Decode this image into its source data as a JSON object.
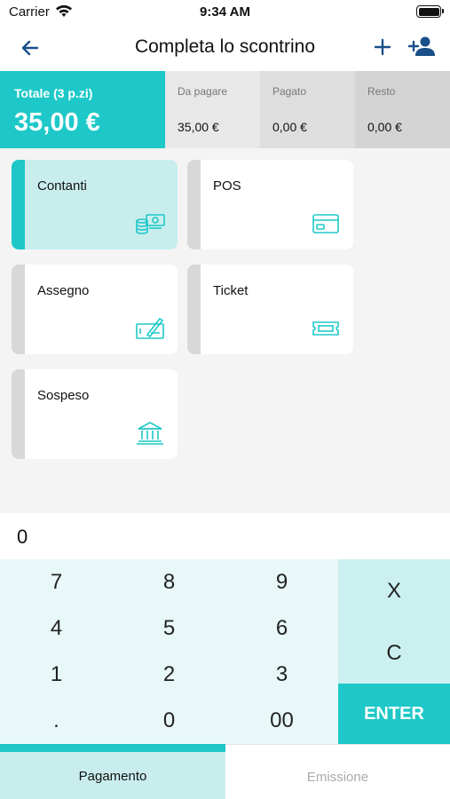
{
  "status_bar": {
    "carrier": "Carrier",
    "time": "9:34 AM"
  },
  "navbar": {
    "title": "Completa lo scontrino"
  },
  "totals": {
    "total_label": "Totale (3 p.zi)",
    "total_value": "35,00 €",
    "cells": [
      {
        "label": "Da pagare",
        "value": "35,00 €"
      },
      {
        "label": "Pagato",
        "value": "0,00 €"
      },
      {
        "label": "Resto",
        "value": "0,00 €"
      }
    ]
  },
  "payment_methods": [
    {
      "label": "Contanti",
      "icon": "cash-icon",
      "selected": true
    },
    {
      "label": "POS",
      "icon": "credit-card-icon",
      "selected": false
    },
    {
      "label": "Assegno",
      "icon": "cheque-icon",
      "selected": false
    },
    {
      "label": "Ticket",
      "icon": "ticket-icon",
      "selected": false
    },
    {
      "label": "Sospeso",
      "icon": "bank-icon",
      "selected": false
    }
  ],
  "amount": {
    "value": "0"
  },
  "keypad": {
    "keys": [
      "7",
      "8",
      "9",
      "4",
      "5",
      "6",
      "1",
      "2",
      "3",
      ".",
      "0",
      "00"
    ],
    "side": {
      "clear_all": "X",
      "clear": "C",
      "enter": "ENTER"
    }
  },
  "tabs": [
    {
      "label": "Pagamento",
      "active": true
    },
    {
      "label": "Emissione",
      "active": false
    }
  ],
  "colors": {
    "accent": "#1ec8c8",
    "accent_light": "#c9eded",
    "nav_blue": "#1a4f8a"
  }
}
